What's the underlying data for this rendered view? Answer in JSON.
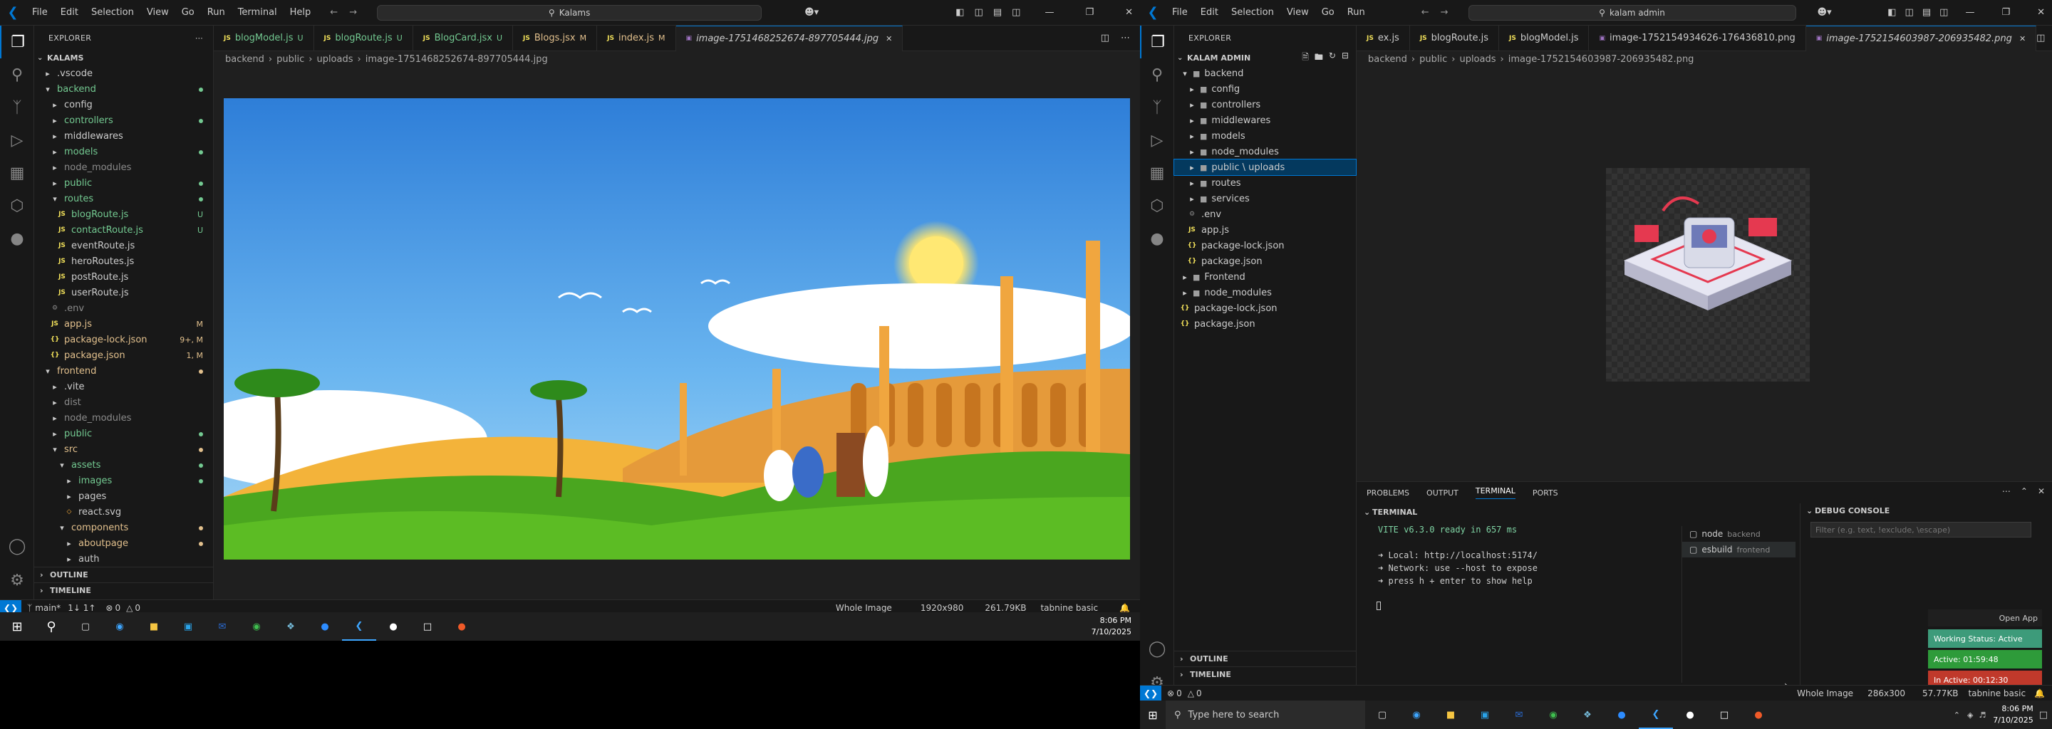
{
  "left": {
    "title": "Kalams",
    "menu": [
      "File",
      "Edit",
      "Selection",
      "View",
      "Go",
      "Run",
      "Terminal",
      "Help"
    ],
    "explorer_title": "EXPLORER",
    "project": "KALAMS",
    "tree": [
      {
        "label": ".vscode",
        "depth": 1,
        "type": "folder",
        "open": false,
        "color": "#cccccc",
        "status": ""
      },
      {
        "label": "backend",
        "depth": 1,
        "type": "folder",
        "open": true,
        "color": "#73c991",
        "status": "dot"
      },
      {
        "label": "config",
        "depth": 2,
        "type": "folder",
        "open": false,
        "color": "#cccccc",
        "status": ""
      },
      {
        "label": "controllers",
        "depth": 2,
        "type": "folder",
        "open": false,
        "color": "#73c991",
        "status": "dot"
      },
      {
        "label": "middlewares",
        "depth": 2,
        "type": "folder",
        "open": false,
        "color": "#cccccc",
        "status": ""
      },
      {
        "label": "models",
        "depth": 2,
        "type": "folder",
        "open": false,
        "color": "#73c991",
        "status": "dot"
      },
      {
        "label": "node_modules",
        "depth": 2,
        "type": "folder",
        "open": false,
        "color": "#8b8b8b",
        "status": ""
      },
      {
        "label": "public",
        "depth": 2,
        "type": "folder",
        "open": false,
        "color": "#73c991",
        "status": "dot"
      },
      {
        "label": "routes",
        "depth": 2,
        "type": "folder",
        "open": true,
        "color": "#73c991",
        "status": "dot"
      },
      {
        "label": "blogRoute.js",
        "depth": 3,
        "type": "js",
        "color": "#73c991",
        "status": "U"
      },
      {
        "label": "contactRoute.js",
        "depth": 3,
        "type": "js",
        "color": "#73c991",
        "status": "U"
      },
      {
        "label": "eventRoute.js",
        "depth": 3,
        "type": "js",
        "color": "#cccccc",
        "status": ""
      },
      {
        "label": "heroRoutes.js",
        "depth": 3,
        "type": "js",
        "color": "#cccccc",
        "status": ""
      },
      {
        "label": "postRoute.js",
        "depth": 3,
        "type": "js",
        "color": "#cccccc",
        "status": ""
      },
      {
        "label": "userRoute.js",
        "depth": 3,
        "type": "js",
        "color": "#cccccc",
        "status": ""
      },
      {
        "label": ".env",
        "depth": 2,
        "type": "env",
        "color": "#8b8b8b",
        "status": ""
      },
      {
        "label": "app.js",
        "depth": 2,
        "type": "js",
        "color": "#e2c08d",
        "status": "M"
      },
      {
        "label": "package-lock.json",
        "depth": 2,
        "type": "json",
        "color": "#e2c08d",
        "status": "9+, M"
      },
      {
        "label": "package.json",
        "depth": 2,
        "type": "json",
        "color": "#e2c08d",
        "status": "1, M"
      },
      {
        "label": "frontend",
        "depth": 1,
        "type": "folder",
        "open": true,
        "color": "#e2c08d",
        "status": "dot"
      },
      {
        "label": ".vite",
        "depth": 2,
        "type": "folder",
        "open": false,
        "color": "#cccccc",
        "status": ""
      },
      {
        "label": "dist",
        "depth": 2,
        "type": "folder",
        "open": false,
        "color": "#8b8b8b",
        "status": ""
      },
      {
        "label": "node_modules",
        "depth": 2,
        "type": "folder",
        "open": false,
        "color": "#8b8b8b",
        "status": ""
      },
      {
        "label": "public",
        "depth": 2,
        "type": "folder",
        "open": false,
        "color": "#73c991",
        "status": "dot"
      },
      {
        "label": "src",
        "depth": 2,
        "type": "folder",
        "open": true,
        "color": "#e2c08d",
        "status": "dot"
      },
      {
        "label": "assets",
        "depth": 3,
        "type": "folder",
        "open": true,
        "color": "#73c991",
        "status": "dot"
      },
      {
        "label": "images",
        "depth": 4,
        "type": "folder",
        "open": false,
        "color": "#73c991",
        "status": "dot"
      },
      {
        "label": "pages",
        "depth": 4,
        "type": "folder",
        "open": false,
        "color": "#cccccc",
        "status": ""
      },
      {
        "label": "react.svg",
        "depth": 4,
        "type": "svg",
        "color": "#cccccc",
        "status": ""
      },
      {
        "label": "components",
        "depth": 3,
        "type": "folder",
        "open": true,
        "color": "#e2c08d",
        "status": "dot"
      },
      {
        "label": "aboutpage",
        "depth": 4,
        "type": "folder",
        "open": false,
        "color": "#e2c08d",
        "status": "dot"
      },
      {
        "label": "auth",
        "depth": 4,
        "type": "folder",
        "open": false,
        "color": "#cccccc",
        "status": ""
      }
    ],
    "outline": "OUTLINE",
    "timeline": "TIMELINE",
    "tabs": [
      {
        "label": "blogModel.js",
        "badge": "U",
        "active": false
      },
      {
        "label": "blogRoute.js",
        "badge": "U",
        "active": false
      },
      {
        "label": "BlogCard.jsx",
        "badge": "U",
        "active": false
      },
      {
        "label": "Blogs.jsx",
        "badge": "M",
        "active": false
      },
      {
        "label": "index.js",
        "badge": "M",
        "active": false
      },
      {
        "label": "image-1751468252674-897705444.jpg",
        "badge": "",
        "active": true
      }
    ],
    "breadcrumb": [
      "backend",
      "public",
      "uploads",
      "image-1751468252674-897705444.jpg"
    ],
    "status": {
      "branch": "main*",
      "sync": "1↓ 1↑",
      "problems": "0",
      "warnings": "0",
      "whole": "Whole Image",
      "size": "1920x980",
      "bytes": "261.79KB",
      "tabnine": "tabnine basic"
    },
    "clock": {
      "time": "8:06 PM",
      "date": "7/10/2025"
    }
  },
  "right": {
    "menu": [
      "File",
      "Edit",
      "Selection",
      "View",
      "Go",
      "Run"
    ],
    "search": "kalam admin",
    "explorer_title": "EXPLORER",
    "project": "KALAM ADMIN",
    "tree": [
      {
        "label": "backend",
        "depth": 1,
        "type": "folder",
        "open": true
      },
      {
        "label": "config",
        "depth": 2,
        "type": "folder",
        "open": false
      },
      {
        "label": "controllers",
        "depth": 2,
        "type": "folder",
        "open": false
      },
      {
        "label": "middlewares",
        "depth": 2,
        "type": "folder",
        "open": false
      },
      {
        "label": "models",
        "depth": 2,
        "type": "folder",
        "open": false
      },
      {
        "label": "node_modules",
        "depth": 2,
        "type": "folder",
        "open": false
      },
      {
        "label": "public \\ uploads",
        "depth": 2,
        "type": "folder",
        "open": false,
        "selected": true
      },
      {
        "label": "routes",
        "depth": 2,
        "type": "folder",
        "open": false
      },
      {
        "label": "services",
        "depth": 2,
        "type": "folder",
        "open": false
      },
      {
        "label": ".env",
        "depth": 2,
        "type": "env"
      },
      {
        "label": "app.js",
        "depth": 2,
        "type": "js"
      },
      {
        "label": "package-lock.json",
        "depth": 2,
        "type": "json"
      },
      {
        "label": "package.json",
        "depth": 2,
        "type": "json"
      },
      {
        "label": "Frontend",
        "depth": 1,
        "type": "folder",
        "open": false
      },
      {
        "label": "node_modules",
        "depth": 1,
        "type": "folder",
        "open": false
      },
      {
        "label": "package-lock.json",
        "depth": 1,
        "type": "json"
      },
      {
        "label": "package.json",
        "depth": 1,
        "type": "json"
      }
    ],
    "outline": "OUTLINE",
    "timeline": "TIMELINE",
    "tabs": [
      {
        "label": "ex.js",
        "active": false
      },
      {
        "label": "blogRoute.js",
        "active": false
      },
      {
        "label": "blogModel.js",
        "active": false
      },
      {
        "label": "image-1752154934626-176436810.png",
        "active": false
      },
      {
        "label": "image-1752154603987-206935482.png",
        "active": true
      }
    ],
    "breadcrumb": [
      "backend",
      "public",
      "uploads",
      "image-1752154603987-206935482.png"
    ],
    "panel_tabs": [
      "PROBLEMS",
      "OUTPUT",
      "TERMINAL",
      "PORTS"
    ],
    "terminal_label": "TERMINAL",
    "debug_label": "DEBUG CONSOLE",
    "debug_placeholder": "Filter (e.g. text, !exclude, \\escape)",
    "terminal_lines": [
      "VITE v6.3.0  ready in 657 ms",
      "➜  Local:   http://localhost:5174/",
      "➜  Network: use --host to expose",
      "➜  press h + enter to show help"
    ],
    "terminals": [
      {
        "name": "node",
        "sub": "backend"
      },
      {
        "name": "esbuild",
        "sub": "frontend"
      }
    ],
    "status": {
      "problems": "0",
      "warnings": "0",
      "whole": "Whole Image",
      "size": "286x300",
      "bytes": "57.77KB",
      "tabnine": "tabnine basic"
    },
    "popup": {
      "open": "Open App",
      "working": "Working Status: Active",
      "active": "Active: 01:59:48",
      "inactive": "In Active: 00:12:30"
    },
    "taskbar_search": "Type here to search",
    "clock": {
      "time": "8:06 PM",
      "date": "7/10/2025"
    }
  },
  "colors": {
    "accent": "#0078d4",
    "green": "#73c991",
    "yellow": "#e2c08d",
    "red": "#e06c75"
  }
}
